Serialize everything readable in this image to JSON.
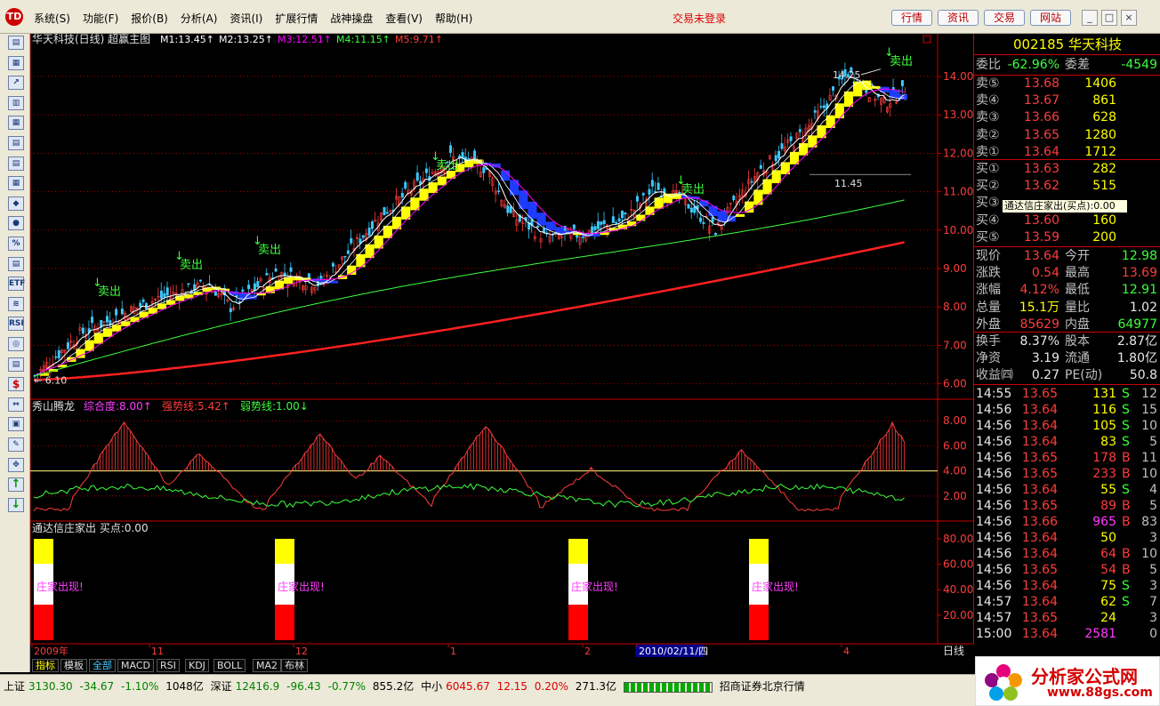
{
  "app": {
    "logo": "TD",
    "login_status": "交易未登录"
  },
  "menu": [
    "系统(S)",
    "功能(F)",
    "报价(B)",
    "分析(A)",
    "资讯(I)",
    "扩展行情",
    "战神操盘",
    "查看(V)",
    "帮助(H)"
  ],
  "top_buttons": [
    "行情",
    "资讯",
    "交易",
    "网站"
  ],
  "window_buttons": [
    "_",
    "□",
    "×"
  ],
  "toolbar": [
    "▤",
    "▦",
    "↗",
    "▥",
    "▦",
    "▤",
    "▤",
    "▦",
    "◆",
    "●",
    "%",
    "▤",
    "ETF",
    "≋",
    "RSI",
    "◎",
    "▤",
    "$",
    "↔",
    "▣",
    "✎",
    "✥",
    "↑",
    "↓"
  ],
  "main_chart": {
    "title": "华天科技(日线) 超赢主图",
    "ma": [
      {
        "label": "M1:13.45",
        "color": "#ffffff"
      },
      {
        "label": "M2:13.25",
        "color": "#ffffff"
      },
      {
        "label": "M3:12.51",
        "color": "#ff00ff"
      },
      {
        "label": "M4:11.15",
        "color": "#3cff3c"
      },
      {
        "label": "M5:9.71",
        "color": "#ff3c3c"
      }
    ],
    "y_ticks": [
      "14.00",
      "13.00",
      "12.00",
      "11.00",
      "10.00",
      "9.00",
      "8.00",
      "7.00",
      "6.00"
    ],
    "annotations": {
      "high": "14.25",
      "low": "6.10",
      "level": "11.45",
      "sell": "卖出"
    }
  },
  "ind1": {
    "name": "秀山腾龙",
    "items": [
      {
        "label": "综合度:8.00",
        "color": "#ff3cff"
      },
      {
        "label": "强势线:5.42",
        "color": "#ff3c3c"
      },
      {
        "label": "弱势线:1.00",
        "color": "#3cff3c"
      }
    ],
    "y_ticks": [
      "8.00",
      "6.00",
      "4.00",
      "2.00"
    ]
  },
  "ind2": {
    "name": "通达信庄家出",
    "buy": "买点:0.00",
    "y_ticks": [
      "80.00",
      "60.00",
      "40.00",
      "20.00"
    ],
    "label": "庄家出现!"
  },
  "x_axis": {
    "labels": [
      "2009年",
      "11",
      "12",
      "1",
      "2",
      "2010/02/11/四",
      "4"
    ],
    "period": "日线"
  },
  "tabs": [
    "指标",
    "模板",
    "全部",
    "MACD",
    "RSI",
    "KDJ",
    "BOLL",
    "MA2",
    "布林"
  ],
  "tooltip": "通达信庄家出(买点):0.00",
  "quote": {
    "code": "002185",
    "name": "华天科技",
    "weibi": {
      "l1": "委比",
      "v1": "-62.96%",
      "l2": "委差",
      "v2": "-4549"
    },
    "sells": [
      {
        "l": "卖⑤",
        "p": "13.68",
        "v": "1406"
      },
      {
        "l": "卖④",
        "p": "13.67",
        "v": "861"
      },
      {
        "l": "卖③",
        "p": "13.66",
        "v": "628"
      },
      {
        "l": "卖②",
        "p": "13.65",
        "v": "1280"
      },
      {
        "l": "卖①",
        "p": "13.64",
        "v": "1712"
      }
    ],
    "buys": [
      {
        "l": "买①",
        "p": "13.63",
        "v": "282"
      },
      {
        "l": "买②",
        "p": "13.62",
        "v": "515"
      },
      {
        "l": "买③",
        "p": "",
        "v": ""
      },
      {
        "l": "买④",
        "p": "13.60",
        "v": "160"
      },
      {
        "l": "买⑤",
        "p": "13.59",
        "v": "200"
      }
    ],
    "stats": [
      {
        "l1": "现价",
        "v1": "13.64",
        "l2": "今开",
        "v2": "12.98"
      },
      {
        "l1": "涨跌",
        "v1": "0.54",
        "l2": "最高",
        "v2": "13.69"
      },
      {
        "l1": "涨幅",
        "v1": "4.12%",
        "l2": "最低",
        "v2": "12.91"
      },
      {
        "l1": "总量",
        "v1": "15.1万",
        "l2": "量比",
        "v2": "1.02"
      },
      {
        "l1": "外盘",
        "v1": "85629",
        "l2": "内盘",
        "v2": "64977"
      }
    ],
    "stats2": [
      {
        "l1": "换手",
        "v1": "8.37%",
        "l2": "股本",
        "v2": "2.87亿"
      },
      {
        "l1": "净资",
        "v1": "3.19",
        "l2": "流通",
        "v2": "1.80亿"
      },
      {
        "l1": "收益㈣",
        "v1": "0.27",
        "l2": "PE(动)",
        "v2": "50.8"
      }
    ],
    "ticks": [
      {
        "t": "14:55",
        "p": "13.65",
        "v": "131",
        "s": "S",
        "n": "12"
      },
      {
        "t": "14:56",
        "p": "13.64",
        "v": "116",
        "s": "S",
        "n": "15"
      },
      {
        "t": "14:56",
        "p": "13.64",
        "v": "105",
        "s": "S",
        "n": "10"
      },
      {
        "t": "14:56",
        "p": "13.64",
        "v": "83",
        "s": "S",
        "n": "5"
      },
      {
        "t": "14:56",
        "p": "13.65",
        "v": "178",
        "s": "B",
        "n": "11"
      },
      {
        "t": "14:56",
        "p": "13.65",
        "v": "233",
        "s": "B",
        "n": "10"
      },
      {
        "t": "14:56",
        "p": "13.64",
        "v": "55",
        "s": "S",
        "n": "4"
      },
      {
        "t": "14:56",
        "p": "13.65",
        "v": "89",
        "s": "B",
        "n": "5"
      },
      {
        "t": "14:56",
        "p": "13.66",
        "v": "965",
        "s": "B",
        "n": "83"
      },
      {
        "t": "14:56",
        "p": "13.64",
        "v": "50",
        "s": "",
        "n": "3"
      },
      {
        "t": "14:56",
        "p": "13.64",
        "v": "64",
        "s": "B",
        "n": "10"
      },
      {
        "t": "14:56",
        "p": "13.65",
        "v": "54",
        "s": "B",
        "n": "5"
      },
      {
        "t": "14:56",
        "p": "13.64",
        "v": "75",
        "s": "S",
        "n": "3"
      },
      {
        "t": "14:57",
        "p": "13.64",
        "v": "62",
        "s": "S",
        "n": "7"
      },
      {
        "t": "14:57",
        "p": "13.65",
        "v": "24",
        "s": "",
        "n": "3"
      },
      {
        "t": "15:00",
        "p": "13.64",
        "v": "2581",
        "s": "",
        "n": "0"
      }
    ]
  },
  "status": {
    "sh_label": "上证",
    "sh_val": "3130.30",
    "sh_chg": "-34.67",
    "sh_pct": "-1.10%",
    "sh_amt": "1048亿",
    "sz_label": "深证",
    "sz_val": "12416.9",
    "sz_chg": "-96.43",
    "sz_pct": "-0.77%",
    "sz_amt": "855.2亿",
    "zx_label": "中小",
    "zx_val": "6045.67",
    "zx_chg": "12.15",
    "zx_pct": "0.20%",
    "zx_amt": "271.3亿",
    "broker": "招商证券北京行情"
  },
  "watermark": {
    "line1": "分析家公式网",
    "line2": "www.88gs.com"
  }
}
